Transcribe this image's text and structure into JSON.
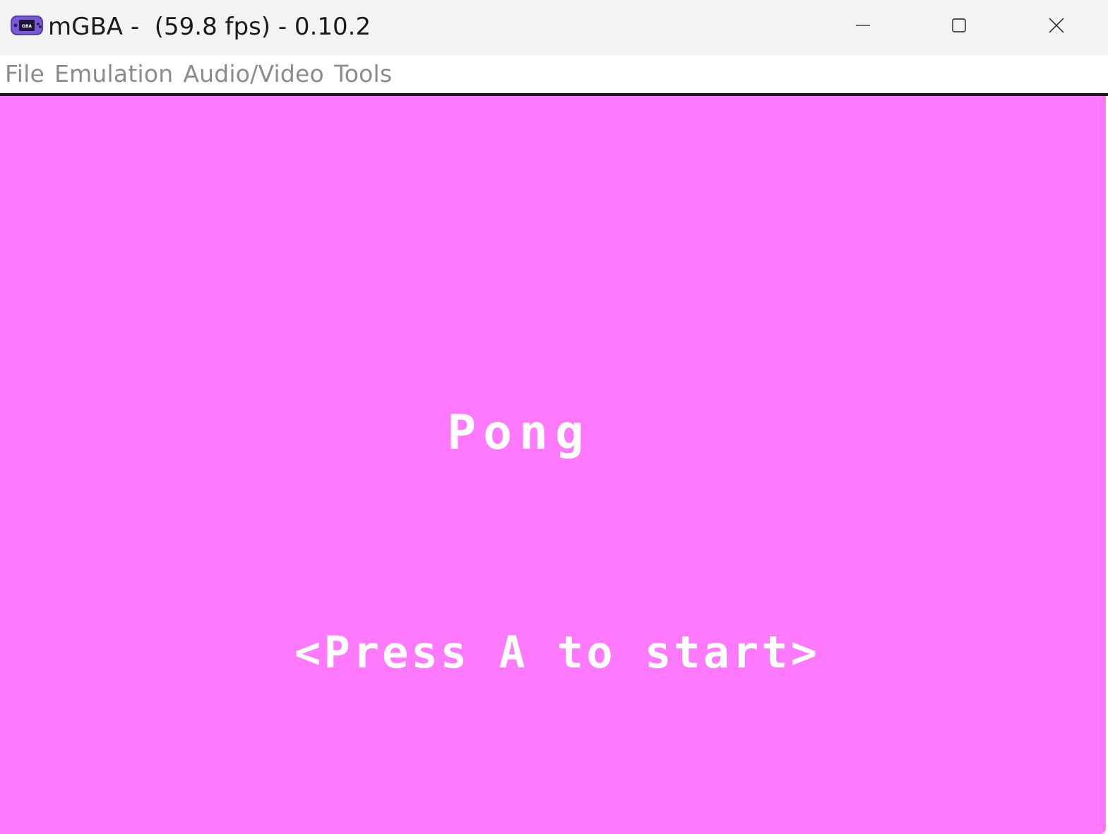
{
  "window": {
    "title": "mGBA -  (59.8 fps) - 0.10.2",
    "icon": "gba-console-icon",
    "controls": {
      "minimize": "minimize-icon",
      "maximize": "maximize-icon",
      "close": "close-icon"
    }
  },
  "menubar": {
    "items": [
      {
        "label": "File"
      },
      {
        "label": "Emulation"
      },
      {
        "label": "Audio/Video"
      },
      {
        "label": "Tools"
      }
    ]
  },
  "game": {
    "title": "Pong",
    "prompt": "<Press A to start>",
    "background_color": "#ff79ff",
    "text_color": "#ffffff"
  }
}
